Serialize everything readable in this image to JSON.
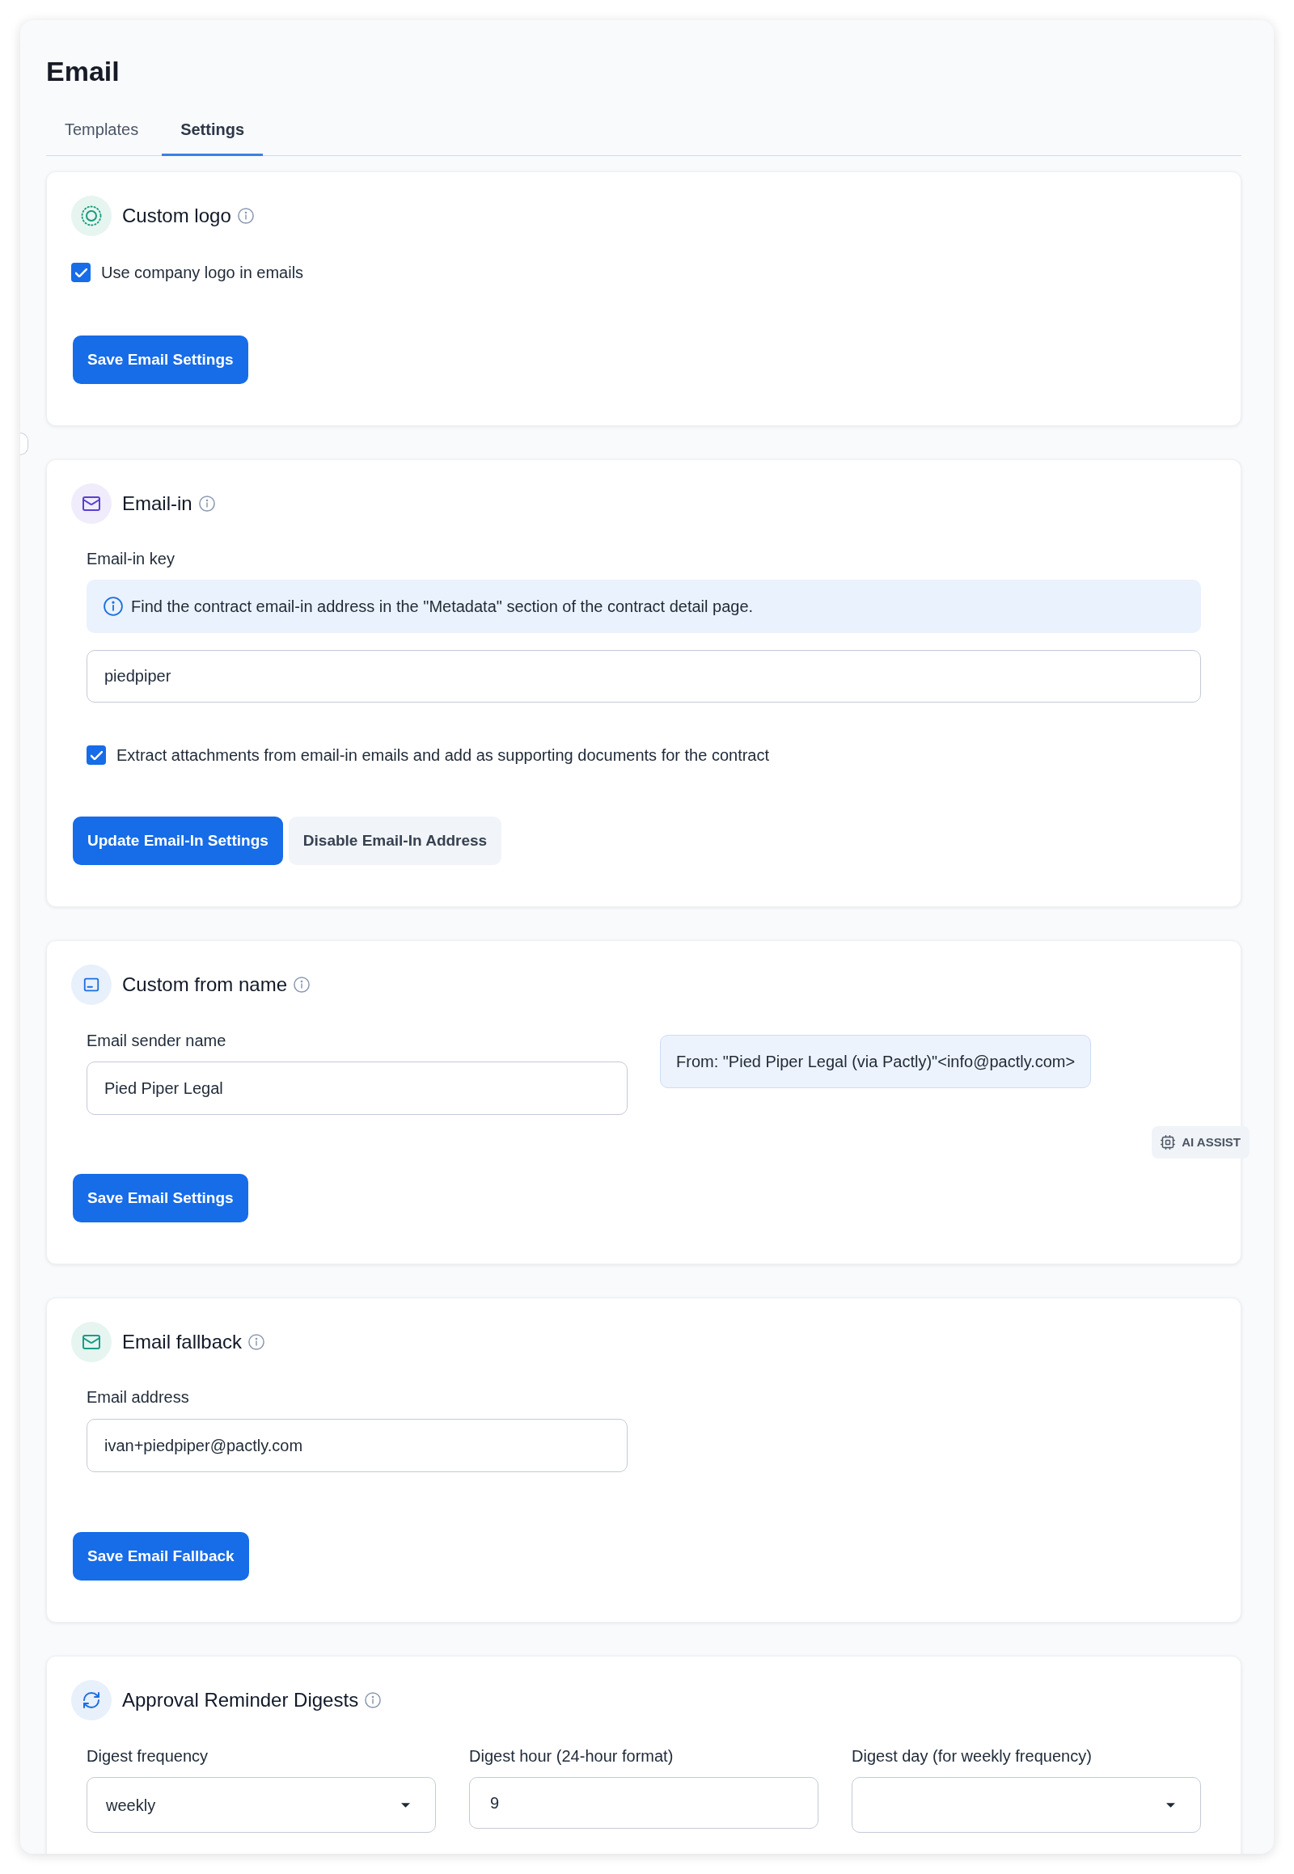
{
  "page": {
    "title": "Email"
  },
  "tabs": [
    {
      "label": "Templates",
      "selected": false
    },
    {
      "label": "Settings",
      "selected": true
    }
  ],
  "sections": [
    {
      "kind": "logo",
      "title": "Custom logo",
      "checkbox": {
        "label": "Use company logo in emails",
        "checked": true
      },
      "buttons": [
        {
          "label": "Save Email Settings",
          "kind": "primary"
        }
      ]
    },
    {
      "kind": "email_in",
      "title": "Email-in",
      "field": {
        "label": "Email-in key",
        "notice": "Find the contract email-in address in the \"Metadata\" section of the contract detail page.",
        "value": "piedpiper"
      },
      "checkbox": {
        "label": "Extract attachments from email-in emails and add as supporting documents for the contract",
        "checked": true
      },
      "buttons": [
        {
          "label": "Update Email-In Settings",
          "kind": "primary"
        },
        {
          "label": "Disable Email-In Address",
          "kind": "secondary"
        }
      ]
    },
    {
      "kind": "from_name",
      "title": "Custom from name",
      "field": {
        "label": "Email sender name",
        "value": "Pied Piper Legal"
      },
      "preview": "From: \"Pied Piper Legal (via Pactly)\"<info@pactly.com>",
      "buttons": [
        {
          "label": "Save Email Settings",
          "kind": "primary"
        }
      ]
    },
    {
      "kind": "fallback",
      "title": "Email fallback",
      "field": {
        "label": "Email address",
        "value": "ivan+piedpiper@pactly.com"
      },
      "buttons": [
        {
          "label": "Save Email Fallback",
          "kind": "primary"
        }
      ]
    },
    {
      "kind": "digests",
      "title": "Approval Reminder Digests",
      "fields": [
        {
          "kind": "select",
          "label": "Digest frequency",
          "value": "weekly"
        },
        {
          "kind": "input",
          "label": "Digest hour (24-hour format)",
          "value": "9"
        },
        {
          "kind": "select",
          "label": "Digest day (for weekly frequency)"
        }
      ]
    }
  ],
  "ai_assist_button": {
    "label": "AI ASSIST"
  }
}
